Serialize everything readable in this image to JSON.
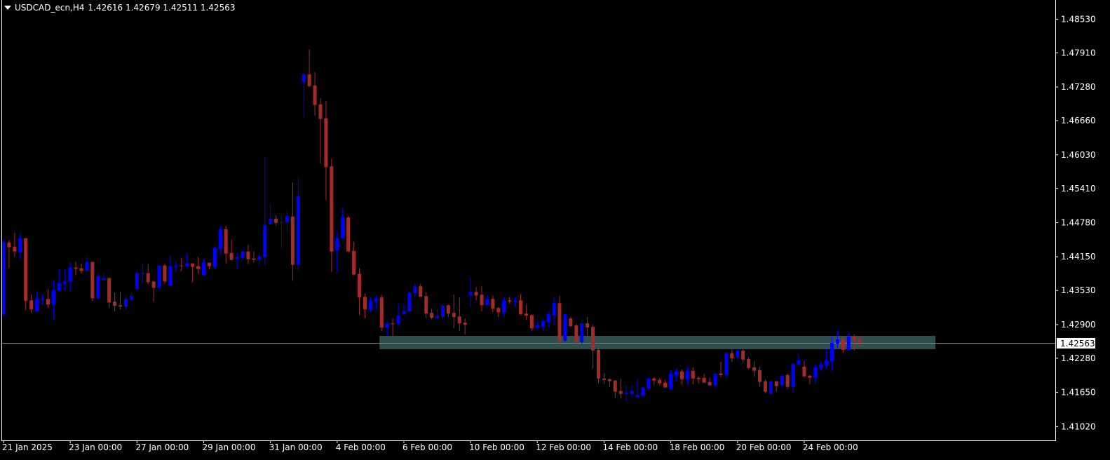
{
  "header": {
    "symbol": "USDCAD_ecn,H4",
    "ohlc": "1.42616 1.42679 1.42511 1.42563"
  },
  "colors": {
    "background": "#000000",
    "bull": "#0000FF",
    "bear": "#A52A2A",
    "zone": "#2F4F4F",
    "price_line": "#778899",
    "axis": "#FFFFFF"
  },
  "chart_data": {
    "type": "candlestick",
    "title": "USDCAD_ecn,H4",
    "timeframe": "H4",
    "ylim": [
      1.408,
      1.488
    ],
    "y_ticks": [
      "1.48530",
      "1.47910",
      "1.47280",
      "1.46660",
      "1.46030",
      "1.45410",
      "1.44780",
      "1.44150",
      "1.43530",
      "1.42900",
      "1.42280",
      "1.41650",
      "1.41020"
    ],
    "x_labels": [
      {
        "index": 0,
        "label": "21 Jan 2025"
      },
      {
        "index": 12,
        "label": "23 Jan 00:00"
      },
      {
        "index": 24,
        "label": "27 Jan 00:00"
      },
      {
        "index": 36,
        "label": "29 Jan 00:00"
      },
      {
        "index": 48,
        "label": "31 Jan 00:00"
      },
      {
        "index": 60,
        "label": "4 Feb 00:00"
      },
      {
        "index": 72,
        "label": "6 Feb 00:00"
      },
      {
        "index": 84,
        "label": "10 Feb 00:00"
      },
      {
        "index": 96,
        "label": "12 Feb 00:00"
      },
      {
        "index": 108,
        "label": "14 Feb 00:00"
      },
      {
        "index": 120,
        "label": "18 Feb 00:00"
      },
      {
        "index": 132,
        "label": "20 Feb 00:00"
      },
      {
        "index": 144,
        "label": "24 Feb 00:00"
      }
    ],
    "current_price": "1.42563",
    "zone": {
      "from_index": 68,
      "to_index": 168,
      "low": 1.42447,
      "high": 1.42692
    },
    "ohlc": [
      [
        1.4309,
        1.44466,
        1.43052,
        1.44428
      ],
      [
        1.44415,
        1.44466,
        1.43939,
        1.44325
      ],
      [
        1.44338,
        1.44595,
        1.44145,
        1.44248
      ],
      [
        1.44235,
        1.44582,
        1.44106,
        1.44492
      ],
      [
        1.44492,
        1.44505,
        1.43167,
        1.43335
      ],
      [
        1.43347,
        1.4345,
        1.43116,
        1.4318
      ],
      [
        1.43142,
        1.43515,
        1.43142,
        1.43373
      ],
      [
        1.4336,
        1.4345,
        1.4327,
        1.43373
      ],
      [
        1.43373,
        1.43553,
        1.43206,
        1.4327
      ],
      [
        1.4327,
        1.4372,
        1.42987,
        1.4354
      ],
      [
        1.43528,
        1.43926,
        1.43515,
        1.43669
      ],
      [
        1.43656,
        1.43913,
        1.43528,
        1.43695
      ],
      [
        1.43695,
        1.44055,
        1.43515,
        1.43952
      ],
      [
        1.43952,
        1.44055,
        1.4381,
        1.43926
      ],
      [
        1.43939,
        1.44029,
        1.43836,
        1.43888
      ],
      [
        1.439,
        1.44145,
        1.43862,
        1.44055
      ],
      [
        1.44055,
        1.44055,
        1.43335,
        1.43386
      ],
      [
        1.43386,
        1.43849,
        1.43386,
        1.43798
      ],
      [
        1.4372,
        1.43849,
        1.4372,
        1.43759
      ],
      [
        1.43759,
        1.43759,
        1.43206,
        1.43309
      ],
      [
        1.43322,
        1.43489,
        1.43142,
        1.43245
      ],
      [
        1.43257,
        1.43502,
        1.4318,
        1.43232
      ],
      [
        1.43232,
        1.43425,
        1.43167,
        1.43373
      ],
      [
        1.4336,
        1.43502,
        1.43335,
        1.43425
      ],
      [
        1.43553,
        1.43888,
        1.43553,
        1.43849
      ],
      [
        1.43836,
        1.44029,
        1.43656,
        1.43849
      ],
      [
        1.43849,
        1.44016,
        1.43643,
        1.43682
      ],
      [
        1.43695,
        1.43708,
        1.43322,
        1.43579
      ],
      [
        1.43579,
        1.4399,
        1.43553,
        1.4399
      ],
      [
        1.4399,
        1.44029,
        1.43656,
        1.43695
      ],
      [
        1.43618,
        1.44171,
        1.43618,
        1.43978
      ],
      [
        1.43965,
        1.44068,
        1.43875,
        1.4399
      ],
      [
        1.4399,
        1.44132,
        1.43888,
        1.43978
      ],
      [
        1.43978,
        1.44209,
        1.43952,
        1.44029
      ],
      [
        1.44029,
        1.44029,
        1.43682,
        1.43965
      ],
      [
        1.43978,
        1.44145,
        1.43836,
        1.43926
      ],
      [
        1.4381,
        1.44106,
        1.4381,
        1.44042
      ],
      [
        1.44042,
        1.44042,
        1.43913,
        1.43978
      ],
      [
        1.43965,
        1.44351,
        1.43926,
        1.44312
      ],
      [
        1.44299,
        1.44723,
        1.44183,
        1.44659
      ],
      [
        1.44659,
        1.44723,
        1.44029,
        1.44209
      ],
      [
        1.44222,
        1.44466,
        1.4408,
        1.44093
      ],
      [
        1.44106,
        1.44235,
        1.43926,
        1.44145
      ],
      [
        1.44132,
        1.44261,
        1.4408,
        1.44248
      ],
      [
        1.44248,
        1.44376,
        1.44016,
        1.44106
      ],
      [
        1.44119,
        1.44248,
        1.44042,
        1.44093
      ],
      [
        1.44093,
        1.44235,
        1.4399,
        1.44158
      ],
      [
        1.44145,
        1.45971,
        1.4399,
        1.44736
      ],
      [
        1.44749,
        1.45122,
        1.44749,
        1.44852
      ],
      [
        1.44852,
        1.44916,
        1.44723,
        1.44775
      ],
      [
        1.44775,
        1.44929,
        1.44312,
        1.44788
      ],
      [
        1.44788,
        1.44994,
        1.44608,
        1.44903
      ],
      [
        1.44891,
        1.45521,
        1.43708,
        1.44003
      ],
      [
        1.44003,
        1.45611,
        1.439,
        1.45264
      ],
      [
        1.47373,
        1.47553,
        1.46717,
        1.47514
      ],
      [
        1.47514,
        1.47977,
        1.4727,
        1.47295
      ],
      [
        1.47308,
        1.47553,
        1.46755,
        1.46948
      ],
      [
        1.46961,
        1.47077,
        1.45868,
        1.46691
      ],
      [
        1.46704,
        1.47025,
        1.45199,
        1.45804
      ],
      [
        1.45817,
        1.45958,
        1.43875,
        1.44248
      ],
      [
        1.44261,
        1.44633,
        1.43862,
        1.44505
      ],
      [
        1.44492,
        1.45045,
        1.44479,
        1.44891
      ],
      [
        1.44878,
        1.44903,
        1.44235,
        1.44248
      ],
      [
        1.44261,
        1.44428,
        1.4381,
        1.43823
      ],
      [
        1.43836,
        1.43939,
        1.43077,
        1.43399
      ],
      [
        1.43412,
        1.43476,
        1.43013,
        1.4318
      ],
      [
        1.4318,
        1.43399,
        1.43129,
        1.43347
      ],
      [
        1.43335,
        1.4345,
        1.4318,
        1.43386
      ],
      [
        1.43399,
        1.4345,
        1.42782,
        1.42846
      ],
      [
        1.42846,
        1.42962,
        1.42692,
        1.42923
      ],
      [
        1.42923,
        1.43013,
        1.42692,
        1.4291
      ],
      [
        1.4291,
        1.43283,
        1.42859,
        1.43065
      ],
      [
        1.4309,
        1.43283,
        1.4309,
        1.43155
      ],
      [
        1.43142,
        1.43515,
        1.43142,
        1.43489
      ],
      [
        1.43476,
        1.43669,
        1.43399,
        1.43605
      ],
      [
        1.43605,
        1.43656,
        1.43412,
        1.43412
      ],
      [
        1.43425,
        1.43502,
        1.43026,
        1.43103
      ],
      [
        1.43116,
        1.43193,
        1.43,
        1.43026
      ],
      [
        1.43013,
        1.43193,
        1.43013,
        1.43065
      ],
      [
        1.43039,
        1.4327,
        1.43,
        1.43257
      ],
      [
        1.43257,
        1.4327,
        1.43039,
        1.43103
      ],
      [
        1.43116,
        1.4345,
        1.42833,
        1.43039
      ],
      [
        1.43052,
        1.43399,
        1.42782,
        1.42923
      ],
      [
        1.42936,
        1.43013,
        1.42717,
        1.42897
      ],
      [
        1.43437,
        1.43772,
        1.43219,
        1.43502
      ],
      [
        1.43502,
        1.43592,
        1.43347,
        1.43437
      ],
      [
        1.4345,
        1.43605,
        1.43142,
        1.43257
      ],
      [
        1.43257,
        1.4345,
        1.43257,
        1.43373
      ],
      [
        1.43373,
        1.43437,
        1.43129,
        1.43193
      ],
      [
        1.43206,
        1.43232,
        1.43039,
        1.43129
      ],
      [
        1.43129,
        1.43412,
        1.43052,
        1.43347
      ],
      [
        1.43347,
        1.43412,
        1.43283,
        1.43322
      ],
      [
        1.43322,
        1.43412,
        1.43232,
        1.43347
      ],
      [
        1.43347,
        1.43463,
        1.43077,
        1.4309
      ],
      [
        1.43103,
        1.4327,
        1.42987,
        1.43065
      ],
      [
        1.43077,
        1.4309,
        1.42782,
        1.42833
      ],
      [
        1.42846,
        1.42962,
        1.4282,
        1.42885
      ],
      [
        1.42872,
        1.42987,
        1.42782,
        1.42962
      ],
      [
        1.42949,
        1.43142,
        1.42846,
        1.4309
      ],
      [
        1.43077,
        1.43399,
        1.42885,
        1.43296
      ],
      [
        1.43296,
        1.43425,
        1.42537,
        1.42602
      ],
      [
        1.42602,
        1.43103,
        1.42576,
        1.4309
      ],
      [
        1.43013,
        1.43052,
        1.42859,
        1.42872
      ],
      [
        1.42885,
        1.4291,
        1.42537,
        1.42576
      ],
      [
        1.42576,
        1.43,
        1.42537,
        1.42923
      ],
      [
        1.42923,
        1.43039,
        1.42653,
        1.42846
      ],
      [
        1.42859,
        1.42897,
        1.42087,
        1.42422
      ],
      [
        1.42434,
        1.42627,
        1.41817,
        1.41907
      ],
      [
        1.41907,
        1.4201,
        1.41804,
        1.41881
      ],
      [
        1.41894,
        1.41907,
        1.41753,
        1.41856
      ],
      [
        1.41869,
        1.41881,
        1.41547,
        1.41663
      ],
      [
        1.41676,
        1.41907,
        1.41534,
        1.41624
      ],
      [
        1.41624,
        1.41779,
        1.41483,
        1.4165
      ],
      [
        1.41624,
        1.41779,
        1.41547,
        1.41676
      ],
      [
        1.4156,
        1.41894,
        1.4156,
        1.41599
      ],
      [
        1.41586,
        1.41753,
        1.41586,
        1.4174
      ],
      [
        1.41727,
        1.41933,
        1.41689,
        1.41907
      ],
      [
        1.41907,
        1.41933,
        1.41791,
        1.41869
      ],
      [
        1.41881,
        1.4192,
        1.41779,
        1.41817
      ],
      [
        1.4183,
        1.41881,
        1.4174,
        1.4174
      ],
      [
        1.41714,
        1.42061,
        1.41714,
        1.41997
      ],
      [
        1.41971,
        1.42087,
        1.41869,
        1.42036
      ],
      [
        1.42036,
        1.42074,
        1.41791,
        1.41894
      ],
      [
        1.41894,
        1.42126,
        1.41779,
        1.42049
      ],
      [
        1.42049,
        1.42113,
        1.41804,
        1.41907
      ],
      [
        1.4192,
        1.41946,
        1.41817,
        1.41894
      ],
      [
        1.4192,
        1.41984,
        1.4183,
        1.4183
      ],
      [
        1.41843,
        1.4192,
        1.41779,
        1.41779
      ],
      [
        1.41779,
        1.41997,
        1.4174,
        1.41997
      ],
      [
        1.41997,
        1.42216,
        1.41933,
        1.41971
      ],
      [
        1.41971,
        1.42409,
        1.41907,
        1.4237
      ],
      [
        1.4237,
        1.42447,
        1.42216,
        1.4228
      ],
      [
        1.42293,
        1.42434,
        1.42229,
        1.42422
      ],
      [
        1.42422,
        1.42447,
        1.4219,
        1.42254
      ],
      [
        1.42267,
        1.42306,
        1.42087,
        1.421
      ],
      [
        1.42113,
        1.42229,
        1.41946,
        1.42049
      ],
      [
        1.42061,
        1.42126,
        1.41753,
        1.41843
      ],
      [
        1.41856,
        1.41894,
        1.41637,
        1.41663
      ],
      [
        1.41624,
        1.41881,
        1.41624,
        1.41856
      ],
      [
        1.41856,
        1.41856,
        1.41663,
        1.41766
      ],
      [
        1.41779,
        1.41984,
        1.41753,
        1.41959
      ],
      [
        1.41971,
        1.41997,
        1.41714,
        1.41753
      ],
      [
        1.41753,
        1.42203,
        1.4165,
        1.42177
      ],
      [
        1.42164,
        1.42357,
        1.42139,
        1.42242
      ],
      [
        1.42126,
        1.42229,
        1.4192,
        1.41946
      ],
      [
        1.41959,
        1.41971,
        1.41804,
        1.4192
      ],
      [
        1.4192,
        1.42164,
        1.41817,
        1.42113
      ],
      [
        1.421,
        1.42229,
        1.42049,
        1.42164
      ],
      [
        1.42151,
        1.42447,
        1.42074,
        1.42242
      ],
      [
        1.42229,
        1.42679,
        1.42049,
        1.42563
      ],
      [
        1.4255,
        1.42794,
        1.4246,
        1.42627
      ],
      [
        1.42627,
        1.42666,
        1.42383,
        1.42434
      ],
      [
        1.42434,
        1.42743,
        1.42434,
        1.42679
      ],
      [
        1.42679,
        1.42717,
        1.42422,
        1.42614
      ],
      [
        1.42616,
        1.42679,
        1.42511,
        1.42563
      ]
    ]
  }
}
